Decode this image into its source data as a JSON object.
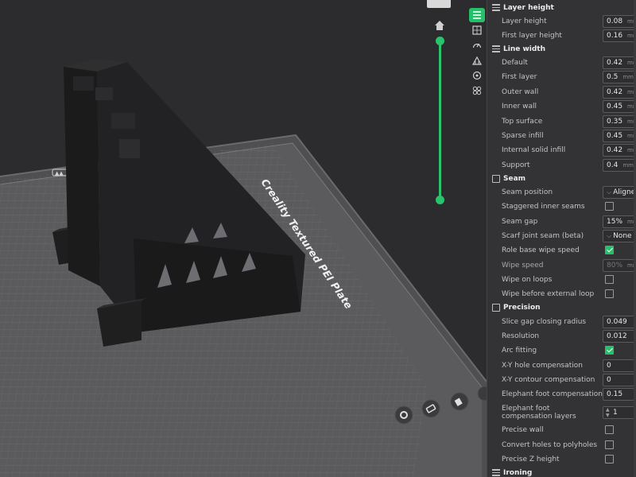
{
  "viewport": {
    "plate_label": "Creality Textured PEI Plate",
    "accent_color": "#27c46b",
    "layer_slider": {
      "top_value": 1.0,
      "bottom_value": 0.0
    },
    "home_icon": "home-icon",
    "bottom_tools": [
      "settings-icon",
      "erase-icon",
      "paint-icon",
      "more-icon"
    ]
  },
  "side_strip": {
    "icons": [
      "process-list-icon",
      "plate-icon",
      "speed-icon",
      "support-icon",
      "multimaterial-icon",
      "others-icon"
    ],
    "active_index": 0
  },
  "panel": {
    "sections": {
      "layer_height": "Layer height",
      "line_width": "Line width",
      "seam": "Seam",
      "precision": "Precision",
      "ironing": "Ironing"
    },
    "layer_height": {
      "layer_height_label": "Layer height",
      "layer_height_value": "0.08",
      "layer_height_unit": "mm",
      "first_layer_height_label": "First layer height",
      "first_layer_height_value": "0.16",
      "first_layer_height_unit": "mm"
    },
    "line_width": {
      "default_label": "Default",
      "default_value": "0.42",
      "first_layer_label": "First layer",
      "first_layer_value": "0.5",
      "outer_wall_label": "Outer wall",
      "outer_wall_value": "0.42",
      "inner_wall_label": "Inner wall",
      "inner_wall_value": "0.45",
      "top_surface_label": "Top surface",
      "top_surface_value": "0.35",
      "sparse_infill_label": "Sparse infill",
      "sparse_infill_value": "0.45",
      "internal_solid_infill_label": "Internal solid infill",
      "internal_solid_infill_value": "0.42",
      "support_label": "Support",
      "support_value": "0.4",
      "unit": "mm"
    },
    "seam": {
      "seam_position_label": "Seam position",
      "seam_position_value": "Aligned",
      "staggered_label": "Staggered inner seams",
      "staggered_checked": false,
      "seam_gap_label": "Seam gap",
      "seam_gap_value": "15%",
      "seam_gap_unit": "mm",
      "scarf_label": "Scarf joint seam (beta)",
      "scarf_value": "None",
      "role_base_label": "Role base wipe speed",
      "role_base_checked": true,
      "wipe_speed_label": "Wipe speed",
      "wipe_speed_value": "80%",
      "wipe_speed_unit": "mm/s",
      "wipe_loops_label": "Wipe on loops",
      "wipe_loops_checked": false,
      "wipe_before_label": "Wipe before external loop",
      "wipe_before_checked": false
    },
    "precision": {
      "slice_gap_label": "Slice gap closing radius",
      "slice_gap_value": "0.049",
      "resolution_label": "Resolution",
      "resolution_value": "0.012",
      "arc_fitting_label": "Arc fitting",
      "arc_fitting_checked": true,
      "xy_hole_label": "X-Y hole compensation",
      "xy_hole_value": "0",
      "xy_contour_label": "X-Y contour compensation",
      "xy_contour_value": "0",
      "elephant_label": "Elephant foot compensation",
      "elephant_value": "0.15",
      "elephant_layers_label": "Elephant foot compensation layers",
      "elephant_layers_value": "1",
      "precise_wall_label": "Precise wall",
      "precise_wall_checked": false,
      "convert_holes_label": "Convert holes to polyholes",
      "convert_holes_checked": false,
      "precise_z_label": "Precise Z height",
      "precise_z_checked": false
    }
  }
}
